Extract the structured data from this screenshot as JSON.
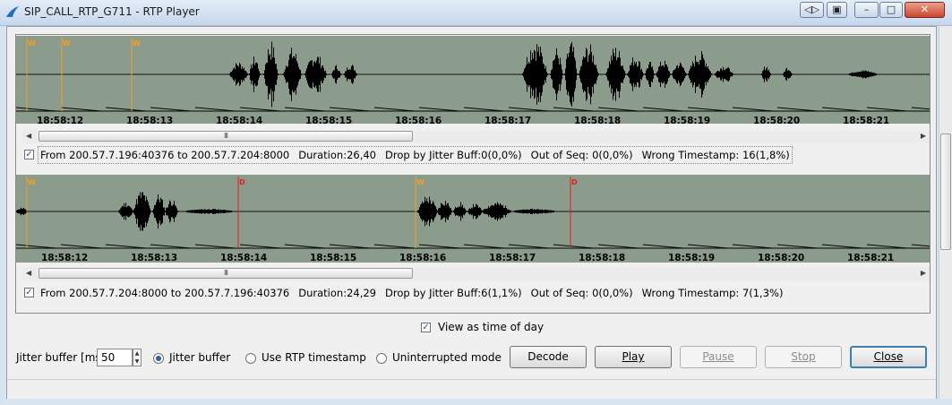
{
  "window": {
    "title": "SIP_CALL_RTP_G711 - RTP Player",
    "buttons": [
      "◁▷",
      "▣",
      "–",
      "□",
      "✕"
    ]
  },
  "streams": [
    {
      "enabled": true,
      "from": "From 200.57.7.196:40376 to 200.57.7.204:8000",
      "duration": "Duration:26,40",
      "drop": "Drop by Jitter Buff:0(0,0%)",
      "out_of_seq": "Out of Seq: 0(0,0%)",
      "wrong_ts": "Wrong Timestamp: 16(1,8%)",
      "times": [
        "18:58:12",
        "18:58:13",
        "18:58:14",
        "18:58:15",
        "18:58:16",
        "18:58:17",
        "18:58:18",
        "18:58:19",
        "18:58:20",
        "18:58:21"
      ],
      "markers": [
        "W",
        "W",
        "W"
      ],
      "scroll_thumb": "III"
    },
    {
      "enabled": true,
      "from": "From 200.57.7.204:8000 to 200.57.7.196:40376",
      "duration": "Duration:24,29",
      "drop": "Drop by Jitter Buff:6(1,1%)",
      "out_of_seq": "Out of Seq: 0(0,0%)",
      "wrong_ts": "Wrong Timestamp: 7(1,3%)",
      "times": [
        "18:58:12",
        "18:58:13",
        "18:58:14",
        "18:58:15",
        "18:58:16",
        "18:58:17",
        "18:58:18",
        "18:58:19",
        "18:58:20",
        "18:58:21"
      ],
      "markers": [
        "W",
        "D",
        "W",
        "D"
      ],
      "scroll_thumb": "III"
    }
  ],
  "view_time_of_day": {
    "label": "View as time of day",
    "checked": true
  },
  "jitter": {
    "label": "Jitter buffer [ms]",
    "value": "50"
  },
  "modes": [
    {
      "label": "Jitter buffer",
      "selected": true
    },
    {
      "label": "Use RTP timestamp",
      "selected": false
    },
    {
      "label": "Uninterrupted mode",
      "selected": false
    }
  ],
  "buttons": {
    "decode": "Decode",
    "play": "Play",
    "pause": "Pause",
    "stop": "Stop",
    "close": "Close"
  },
  "colors": {
    "wave_bg": "#8c9c8c",
    "marker_w": "#f0a020",
    "marker_d": "#e02020"
  }
}
